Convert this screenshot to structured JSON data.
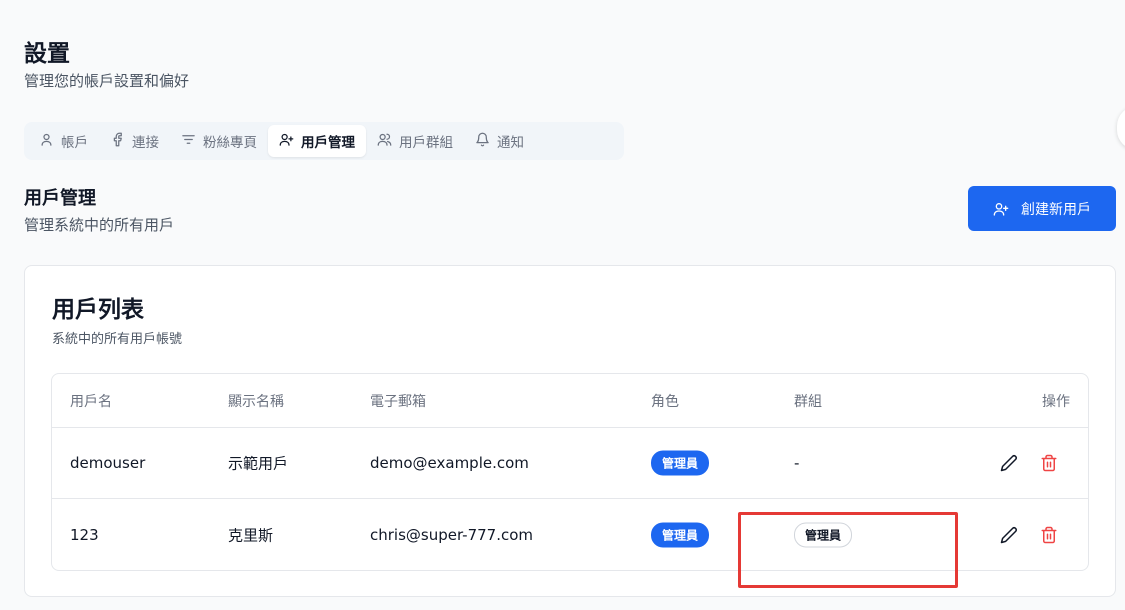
{
  "page": {
    "title": "設置",
    "subtitle": "管理您的帳戶設置和偏好"
  },
  "tabs": [
    {
      "label": "帳戶",
      "icon": "user-icon",
      "active": false
    },
    {
      "label": "連接",
      "icon": "facebook-icon",
      "active": false
    },
    {
      "label": "粉絲專頁",
      "icon": "filter-icon",
      "active": false
    },
    {
      "label": "用戶管理",
      "icon": "user-plus-icon",
      "active": true
    },
    {
      "label": "用戶群組",
      "icon": "users-icon",
      "active": false
    },
    {
      "label": "通知",
      "icon": "bell-icon",
      "active": false
    }
  ],
  "section": {
    "title": "用戶管理",
    "subtitle": "管理系統中的所有用戶",
    "create_button": "創建新用戶"
  },
  "card": {
    "title": "用戶列表",
    "subtitle": "系統中的所有用戶帳號"
  },
  "table": {
    "headers": {
      "username": "用戶名",
      "display_name": "顯示名稱",
      "email": "電子郵箱",
      "role": "角色",
      "group": "群組",
      "actions": "操作"
    },
    "rows": [
      {
        "username": "demouser",
        "display_name": "示範用戶",
        "email": "demo@example.com",
        "role": "管理員",
        "group": "-"
      },
      {
        "username": "123",
        "display_name": "克里斯",
        "email": "chris@super-777.com",
        "role": "管理員",
        "group": "管理員"
      }
    ]
  },
  "colors": {
    "primary": "#1d67f0",
    "danger": "#ef4444",
    "highlight": "#e53935"
  }
}
